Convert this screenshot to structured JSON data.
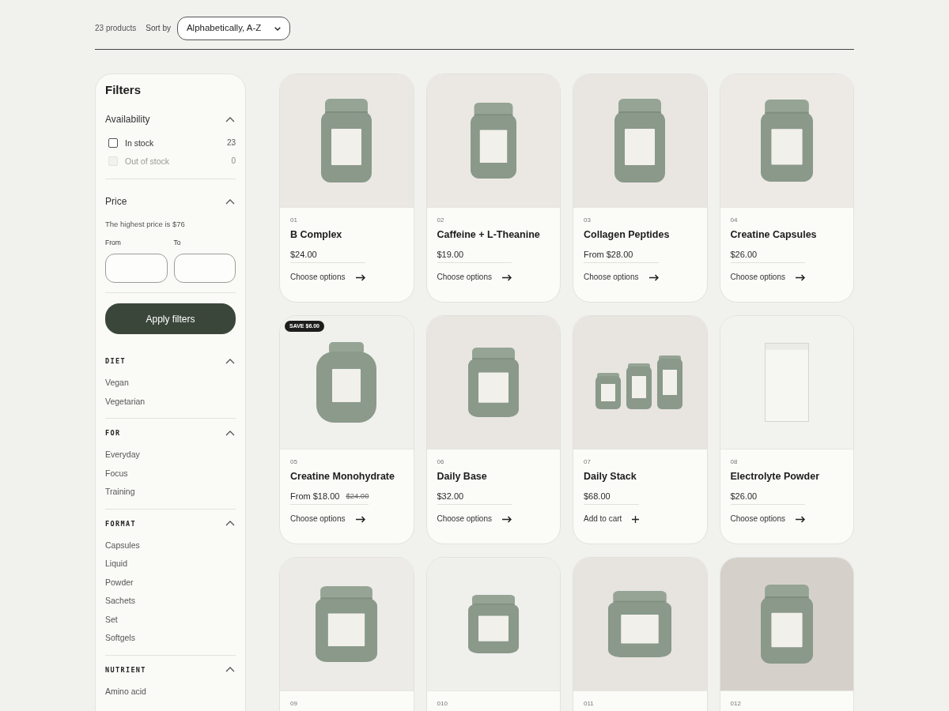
{
  "toolbar": {
    "product_count": "23 products",
    "sort_label": "Sort by",
    "sort_value": "Alphabetically, A-Z"
  },
  "filters": {
    "title": "Filters",
    "availability": {
      "title": "Availability",
      "expanded": true,
      "options": [
        {
          "label": "In stock",
          "count": "23",
          "checked": false,
          "disabled": false
        },
        {
          "label": "Out of stock",
          "count": "0",
          "checked": false,
          "disabled": true
        }
      ]
    },
    "price": {
      "title": "Price",
      "expanded": true,
      "note": "The highest price is $76",
      "from_label": "From",
      "to_label": "To"
    },
    "apply_button": "Apply filters",
    "groups": [
      {
        "title": "DIET",
        "expanded": true,
        "options": [
          "Vegan",
          "Vegetarian"
        ]
      },
      {
        "title": "FOR",
        "expanded": true,
        "options": [
          "Everyday",
          "Focus",
          "Training"
        ]
      },
      {
        "title": "FORMAT",
        "expanded": true,
        "options": [
          "Capsules",
          "Liquid",
          "Powder",
          "Sachets",
          "Set",
          "Softgels"
        ]
      },
      {
        "title": "NUTRIENT",
        "expanded": true,
        "options": [
          "Amino acid"
        ]
      }
    ]
  },
  "products": [
    {
      "number": "01",
      "title": "B Complex",
      "price": "$24.00",
      "action": {
        "kind": "options",
        "label": "Choose options"
      }
    },
    {
      "number": "02",
      "title": "Caffeine + L-Theanine",
      "price": "$19.00",
      "action": {
        "kind": "options",
        "label": "Choose options"
      }
    },
    {
      "number": "03",
      "title": "Collagen Peptides",
      "price": "From $28.00",
      "action": {
        "kind": "options",
        "label": "Choose options"
      }
    },
    {
      "number": "04",
      "title": "Creatine Capsules",
      "price": "$26.00",
      "action": {
        "kind": "options",
        "label": "Choose options"
      }
    },
    {
      "number": "05",
      "badge": "SAVE $6.00",
      "title": "Creatine Monohydrate",
      "price": "From $18.00",
      "compare_price": "$24.00",
      "action": {
        "kind": "options",
        "label": "Choose options"
      }
    },
    {
      "number": "06",
      "title": "Daily Base",
      "price": "$32.00",
      "action": {
        "kind": "options",
        "label": "Choose options"
      }
    },
    {
      "number": "07",
      "title": "Daily Stack",
      "price": "$68.00",
      "action": {
        "kind": "add",
        "label": "Add to cart"
      }
    },
    {
      "number": "08",
      "title": "Electrolyte Powder",
      "price": "$26.00",
      "action": {
        "kind": "options",
        "label": "Choose options"
      }
    },
    {
      "number": "09"
    },
    {
      "number": "010"
    },
    {
      "number": "011"
    },
    {
      "number": "012"
    }
  ]
}
